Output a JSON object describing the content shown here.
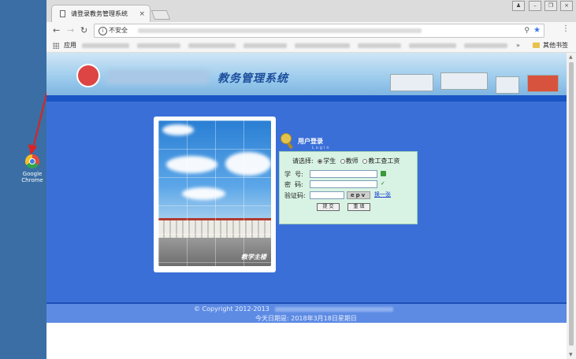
{
  "desktop": {
    "icon_label": "Google\nChrome"
  },
  "browser": {
    "tab_title": "请登录教务管理系统",
    "tab_close": "×",
    "address": {
      "security_label": "不安全",
      "separator": "|"
    },
    "bookmarks": {
      "apps_label": "应用",
      "more": "»",
      "other_label": "其他书签"
    },
    "menu_glyph": "⋮"
  },
  "page": {
    "banner_title": "教务管理系统",
    "photo_caption": "教学主楼",
    "login": {
      "title": "用户登录",
      "subtitle": "Login",
      "select_label": "请选择:",
      "roles": [
        "学生",
        "教师",
        "教工查工资"
      ],
      "selected_role": "学生",
      "student_id_label": "学  号:",
      "password_label": "密  码:",
      "captcha_label": "验证码:",
      "captcha_text": "epv",
      "change_link": "换一张",
      "submit_label": "提 交",
      "reset_label": "重 填"
    },
    "footer": {
      "copyright": "© Copyright 2012-2013",
      "date_text": "今天日期是: 2018年3月18日星期日"
    }
  },
  "colors": {
    "desktop_bg": "#3a6ea5",
    "page_blue": "#3b6fd8",
    "login_box": "#d8f3e3",
    "footer": "#5d8be4"
  }
}
